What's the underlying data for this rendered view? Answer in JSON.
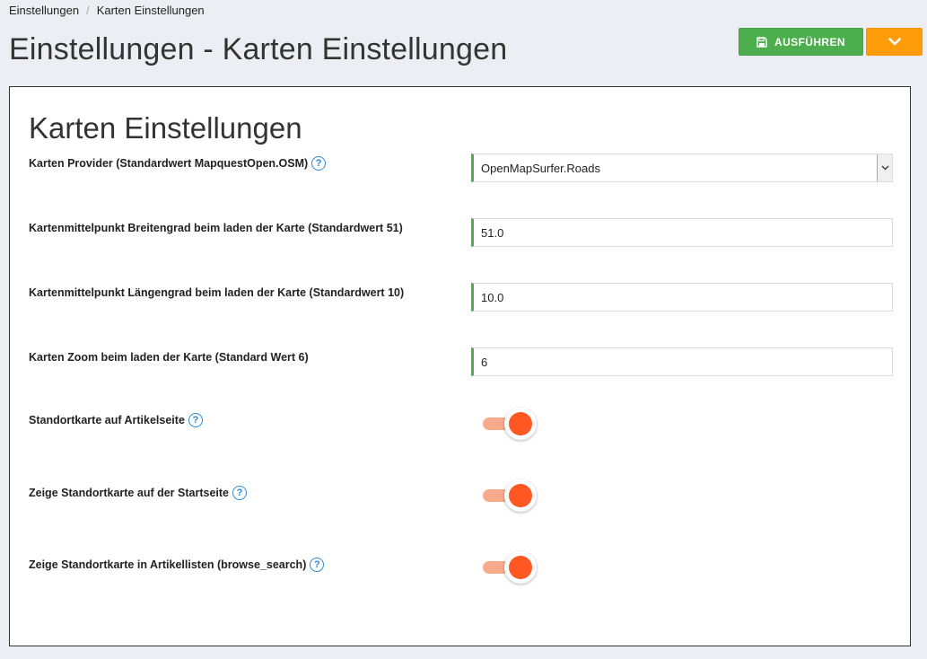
{
  "breadcrumb": {
    "items": [
      "Einstellungen",
      "Karten Einstellungen"
    ],
    "separator": "/"
  },
  "page": {
    "title": "Einstellungen - Karten Einstellungen"
  },
  "toolbar": {
    "run_label": "AUSFÜHREN",
    "run_icon": "save-icon",
    "more_icon": "chevron-down-icon"
  },
  "section": {
    "title": "Karten Einstellungen"
  },
  "settings": [
    {
      "label": "Karten Provider (Standardwert MapquestOpen.OSM)",
      "help": "?",
      "type": "select",
      "value": "OpenMapSurfer.Roads"
    },
    {
      "label": "Kartenmittelpunkt Breitengrad beim laden der Karte (Standardwert 51)",
      "type": "text",
      "value": "51.0"
    },
    {
      "label": "Kartenmittelpunkt Längengrad beim laden der Karte (Standardwert 10)",
      "type": "text",
      "value": "10.0"
    },
    {
      "label": "Karten Zoom beim laden der Karte (Standard Wert 6)",
      "type": "text",
      "value": "6"
    },
    {
      "label": "Standortkarte auf Artikelseite",
      "help": "?",
      "type": "toggle",
      "value": true
    },
    {
      "label": "Zeige Standortkarte auf der Startseite",
      "help": "?",
      "type": "toggle",
      "value": true
    },
    {
      "label": "Zeige Standortkarte in Artikellisten (browse_search)",
      "help": "?",
      "type": "toggle",
      "value": true
    }
  ],
  "colors": {
    "success": "#4cae4c",
    "warning": "#ff9c0a",
    "toggle_on": "#ff5722",
    "help": "#2a8ad8"
  }
}
